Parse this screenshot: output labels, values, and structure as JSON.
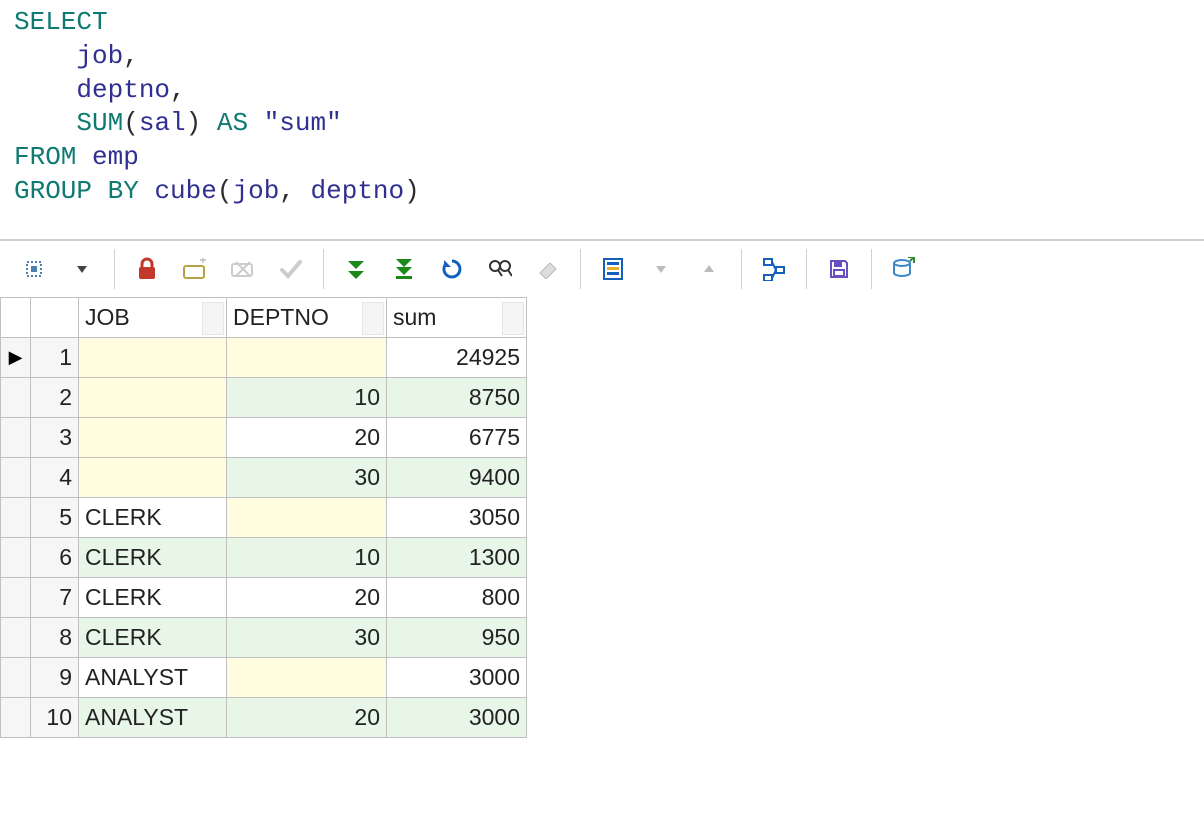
{
  "sql": {
    "k_select": "SELECT",
    "id_job": "job",
    "id_deptno": "deptno",
    "fn_sum": "SUM",
    "id_sal": "sal",
    "k_as": "AS",
    "str_sum": "\"sum\"",
    "k_from": "FROM",
    "id_emp": "emp",
    "k_group": "GROUP",
    "k_by": "BY",
    "fn_cube": "cube",
    "indent": "    "
  },
  "columns": {
    "job": "JOB",
    "deptno": "DEPTNO",
    "sum": "sum"
  },
  "rows": [
    {
      "n": "1",
      "job": "",
      "deptno": "",
      "sum": "24925",
      "job_null": true,
      "dept_null": true
    },
    {
      "n": "2",
      "job": "",
      "deptno": "10",
      "sum": "8750",
      "job_null": true,
      "dept_null": false
    },
    {
      "n": "3",
      "job": "",
      "deptno": "20",
      "sum": "6775",
      "job_null": true,
      "dept_null": false
    },
    {
      "n": "4",
      "job": "",
      "deptno": "30",
      "sum": "9400",
      "job_null": true,
      "dept_null": false
    },
    {
      "n": "5",
      "job": "CLERK",
      "deptno": "",
      "sum": "3050",
      "job_null": false,
      "dept_null": true
    },
    {
      "n": "6",
      "job": "CLERK",
      "deptno": "10",
      "sum": "1300",
      "job_null": false,
      "dept_null": false
    },
    {
      "n": "7",
      "job": "CLERK",
      "deptno": "20",
      "sum": "800",
      "job_null": false,
      "dept_null": false
    },
    {
      "n": "8",
      "job": "CLERK",
      "deptno": "30",
      "sum": "950",
      "job_null": false,
      "dept_null": false
    },
    {
      "n": "9",
      "job": "ANALYST",
      "deptno": "",
      "sum": "3000",
      "job_null": false,
      "dept_null": true
    },
    {
      "n": "10",
      "job": "ANALYST",
      "deptno": "20",
      "sum": "3000",
      "job_null": false,
      "dept_null": false
    }
  ],
  "current_row": "1",
  "chart_data": {
    "type": "table",
    "columns": [
      "JOB",
      "DEPTNO",
      "sum"
    ],
    "rows": [
      [
        null,
        null,
        24925
      ],
      [
        null,
        10,
        8750
      ],
      [
        null,
        20,
        6775
      ],
      [
        null,
        30,
        9400
      ],
      [
        "CLERK",
        null,
        3050
      ],
      [
        "CLERK",
        10,
        1300
      ],
      [
        "CLERK",
        20,
        800
      ],
      [
        "CLERK",
        30,
        950
      ],
      [
        "ANALYST",
        null,
        3000
      ],
      [
        "ANALYST",
        20,
        3000
      ]
    ]
  }
}
